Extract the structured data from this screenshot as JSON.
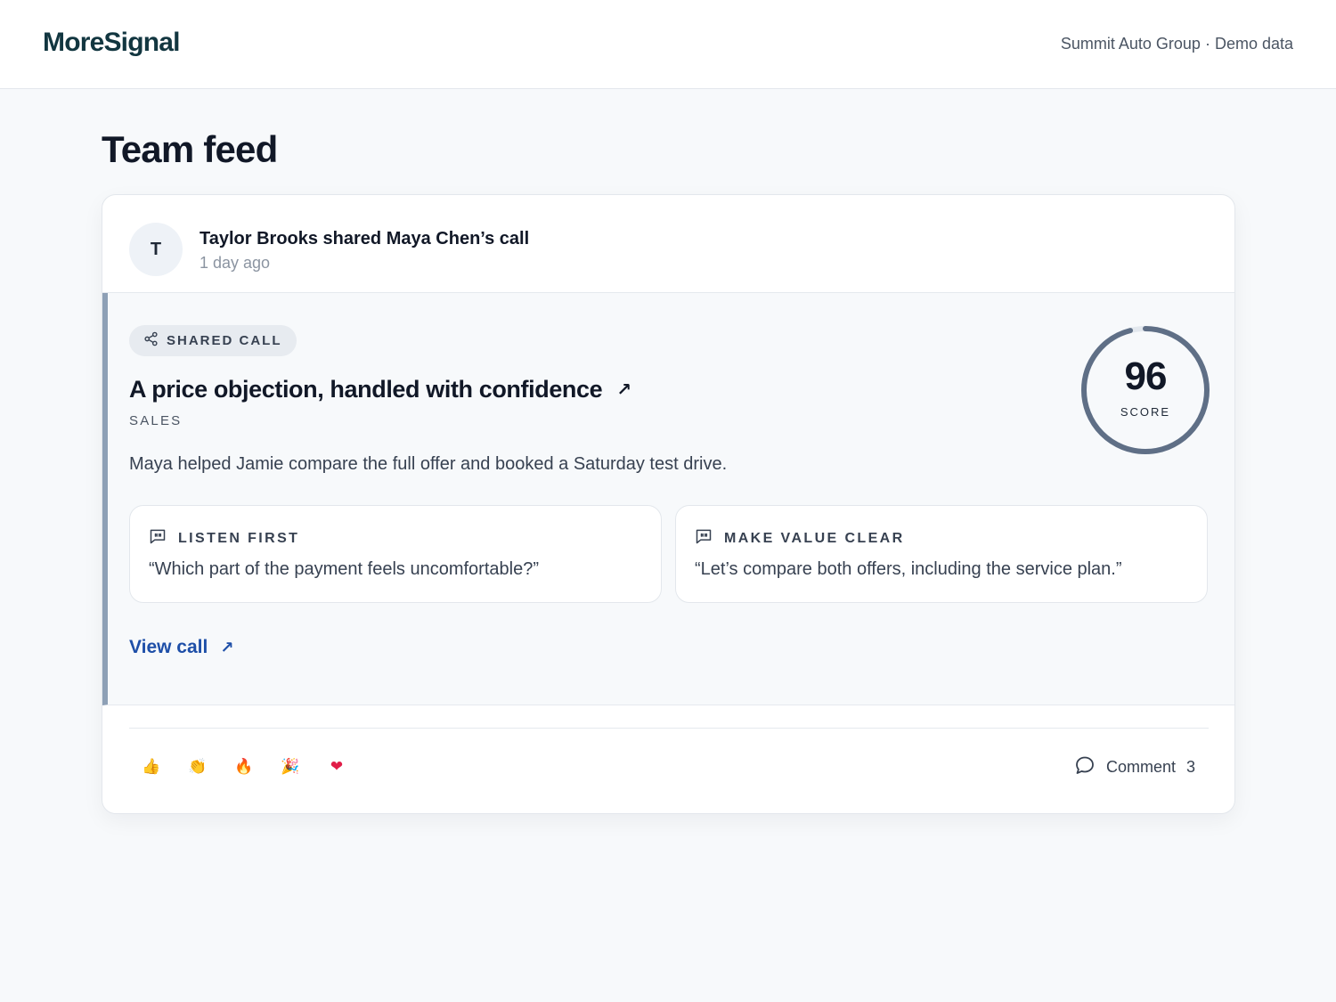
{
  "header": {
    "logo": "MoreSignal",
    "org": "Summit Auto Group · Demo data"
  },
  "page": {
    "title": "Team feed"
  },
  "post": {
    "avatar_initial": "T",
    "title": "Taylor Brooks shared Maya Chen’s call",
    "time": "1 day ago",
    "badge": "SHARED CALL",
    "call_title": "A price objection, handled with confidence",
    "title_arrow": "↗",
    "category": "SALES",
    "summary": "Maya helped Jamie compare the full offer and booked a Saturday test drive.",
    "score": {
      "value": "96",
      "label": "SCORE",
      "fraction": 0.96
    },
    "tips": [
      {
        "label": "LISTEN FIRST",
        "quote": "“Which part of the payment feels uncomfortable?”"
      },
      {
        "label": "MAKE VALUE CLEAR",
        "quote": "“Let’s compare both offers, including the service plan.”"
      }
    ],
    "view_call": "View call",
    "view_arrow": "↗",
    "reactions": [
      "👍",
      "👏",
      "🔥",
      "🎉",
      "❤"
    ],
    "comment_label": "Comment",
    "comment_count": "3"
  },
  "colors": {
    "accent_bar": "#8ea0b6",
    "link": "#1e4fa8",
    "score_ring": "#5f6f86"
  }
}
